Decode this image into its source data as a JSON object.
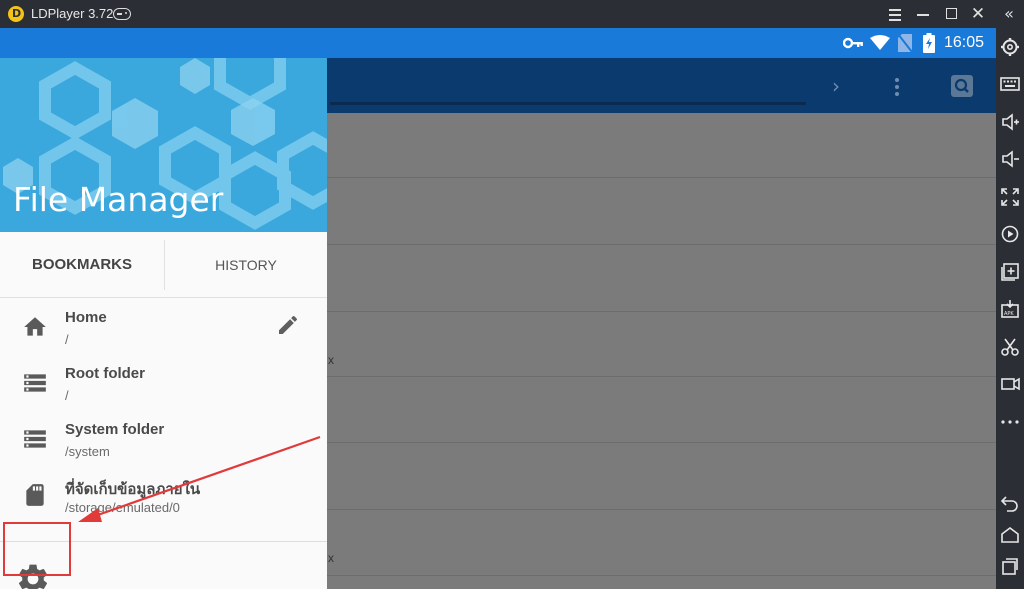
{
  "window": {
    "title": "LDPlayer 3.72"
  },
  "statusbar": {
    "time": "16:05"
  },
  "drawer": {
    "header_title": "File Manager",
    "tabs": [
      {
        "label": "BOOKMARKS",
        "active": true
      },
      {
        "label": "HISTORY",
        "active": false
      }
    ],
    "bookmarks": [
      {
        "name": "Home",
        "path": "/",
        "icon": "home-icon"
      },
      {
        "name": "Root folder",
        "path": "/",
        "icon": "storage-icon"
      },
      {
        "name": "System folder",
        "path": "/system",
        "icon": "storage-icon"
      },
      {
        "name": "ที่จัดเก็บข้อมูลภายใน",
        "path": "/storage/emulated/0",
        "icon": "sd-card-icon"
      }
    ]
  },
  "background_list": {
    "x_labels": [
      "x",
      "x"
    ]
  },
  "sidebar": {
    "icons": [
      "gear-icon",
      "keyboard-icon",
      "volume-up-icon",
      "volume-down-icon",
      "fullscreen-icon",
      "rotate-icon",
      "add-window-icon",
      "apk-install-icon",
      "scissors-icon",
      "record-icon",
      "more-icon",
      "back-icon",
      "home-icon",
      "recent-apps-icon"
    ]
  },
  "colors": {
    "status_bar": "#1a7ad9",
    "app_bar": "#0b3a6e",
    "drawer_header": "#3aa7dd",
    "annotation": "#e03a3a"
  }
}
